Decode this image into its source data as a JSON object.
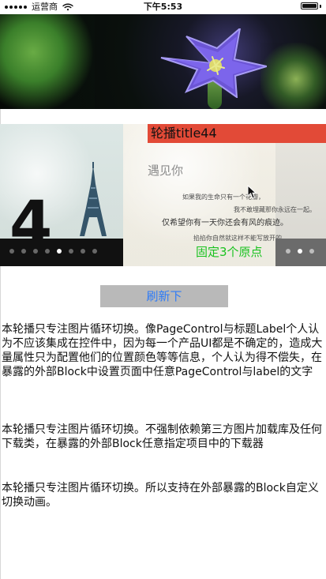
{
  "status_bar": {
    "carrier": "运营商",
    "time": "下午5:53"
  },
  "carousel": {
    "title": "轮播title44",
    "fixed_dots_label": "固定3个原点",
    "dots_left_count": 8,
    "dots_left_active_index": 4,
    "dots_right_count": 3,
    "dots_right_active_index": 1,
    "slide_number": "4",
    "slide_heading": "遇见你",
    "slide_lines": [
      "如果我的生命只有一个花瓣，",
      "我不敢埋藏那你永远在一起。",
      "仅希望你有一天你还会有风的痕迹。",
      "掐掐你自然就这样不能写放开的"
    ]
  },
  "buttons": {
    "refresh": "刷新下"
  },
  "content": {
    "paragraph_1": "本轮播只专注图片循环切换。像PageControl与标题Label个人认为不应该集成在控件中，因为每一个产品UI都是不确定的，造成大量属性只为配置他们的位置颜色等等信息，个人认为得不偿失，在暴露的外部Block中设置页面中任意PageControl与label的文字",
    "paragraph_2": "本轮播只专注图片循环切换。不强制依赖第三方图片加载库及任何下载类，在暴露的外部Block任意指定项目中的下载器",
    "paragraph_3": "本轮播只专注图片循环切换。所以支持在外部暴露的Block自定义切换动画。"
  },
  "colors": {
    "title_bar": "#e24a37",
    "fixed_label": "#19c21f",
    "button_text": "#2f7cf6",
    "button_bg": "#b9b9b9"
  },
  "icons": {
    "wifi": "wifi-icon",
    "battery": "battery-icon",
    "cursor": "mouse-pointer-icon"
  }
}
